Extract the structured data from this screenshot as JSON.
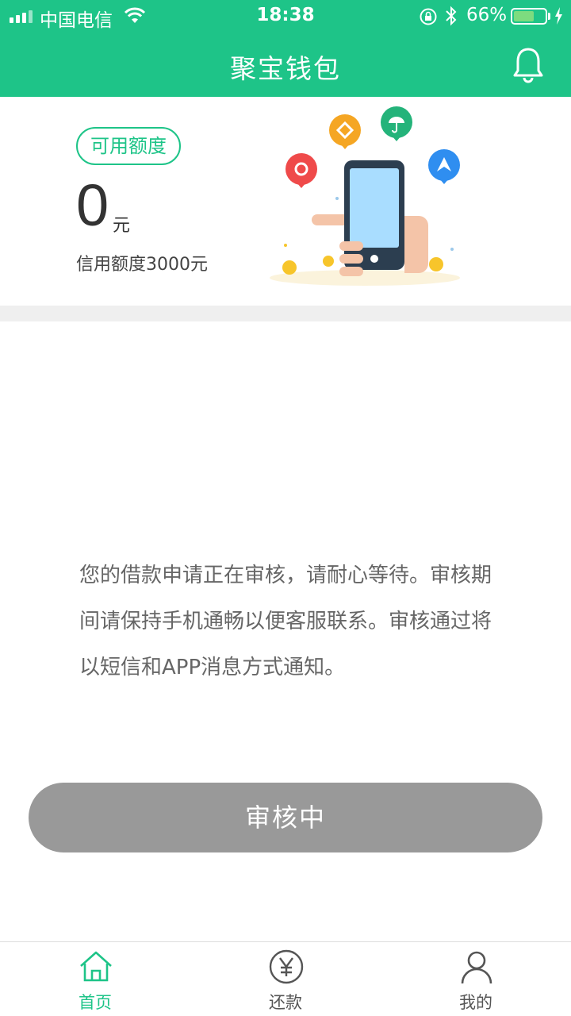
{
  "status_bar": {
    "carrier": "中国电信",
    "time": "18:38",
    "battery_percent": "66%",
    "battery_level": 0.66
  },
  "header": {
    "title": "聚宝钱包",
    "bell_icon": "bell-icon"
  },
  "credit": {
    "badge": "可用额度",
    "amount": "0",
    "unit": "元",
    "limit_text": "信用额度3000元"
  },
  "message": "您的借款申请正在审核，请耐心等待。审核期间请保持手机通畅以便客服联系。审核通过将以短信和APP消息方式通知。",
  "button": {
    "label": "审核中"
  },
  "tabs": [
    {
      "label": "首页",
      "icon": "home-icon",
      "active": true
    },
    {
      "label": "还款",
      "icon": "yen-icon",
      "active": false
    },
    {
      "label": "我的",
      "icon": "user-icon",
      "active": false
    }
  ],
  "colors": {
    "brand": "#1ec488",
    "disabled_button": "#999999"
  }
}
